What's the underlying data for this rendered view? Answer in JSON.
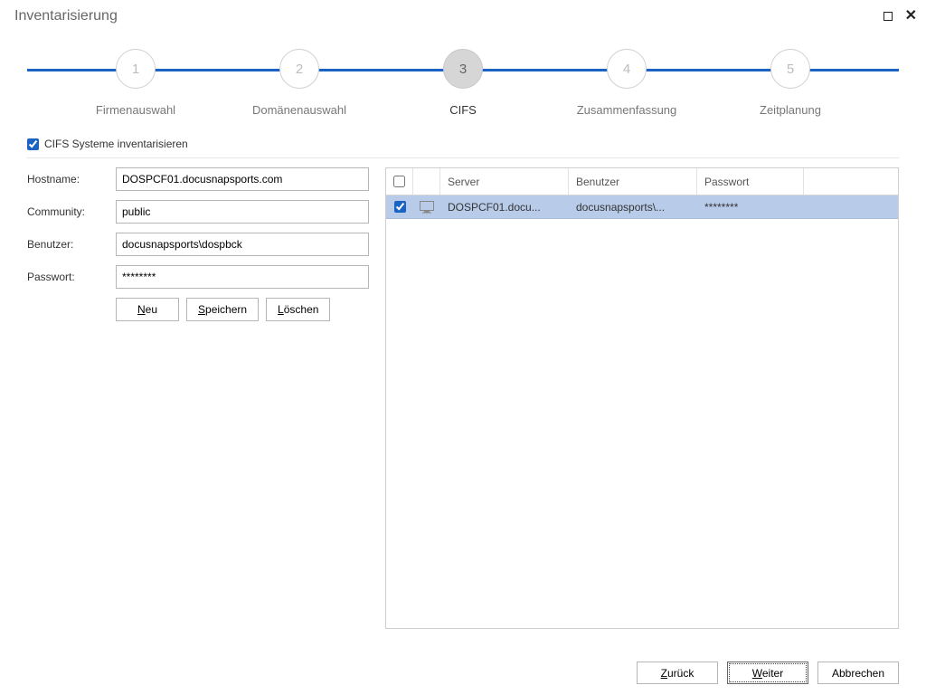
{
  "window": {
    "title": "Inventarisierung"
  },
  "stepper": {
    "steps": [
      {
        "num": "1",
        "label": "Firmenauswahl"
      },
      {
        "num": "2",
        "label": "Domänenauswahl"
      },
      {
        "num": "3",
        "label": "CIFS"
      },
      {
        "num": "4",
        "label": "Zusammenfassung"
      },
      {
        "num": "5",
        "label": "Zeitplanung"
      }
    ],
    "active_index": 2
  },
  "cifs_checkbox": {
    "label": "CIFS Systeme inventarisieren",
    "checked": true
  },
  "form": {
    "hostname": {
      "label": "Hostname:",
      "value": "DOSPCF01.docusnapsports.com"
    },
    "community": {
      "label": "Community:",
      "value": "public"
    },
    "benutzer": {
      "label": "Benutzer:",
      "value": "docusnapsports\\dospbck"
    },
    "passwort": {
      "label": "Passwort:",
      "value": "********"
    },
    "buttons": {
      "neu": "Neu",
      "speichern": "Speichern",
      "loeschen": "Löschen"
    }
  },
  "grid": {
    "headers": {
      "server": "Server",
      "benutzer": "Benutzer",
      "passwort": "Passwort"
    },
    "rows": [
      {
        "checked": true,
        "server": "DOSPCF01.docu...",
        "benutzer": "docusnapsports\\...",
        "passwort": "********"
      }
    ]
  },
  "footer": {
    "back": "Zurück",
    "next": "Weiter",
    "cancel": "Abbrechen"
  }
}
